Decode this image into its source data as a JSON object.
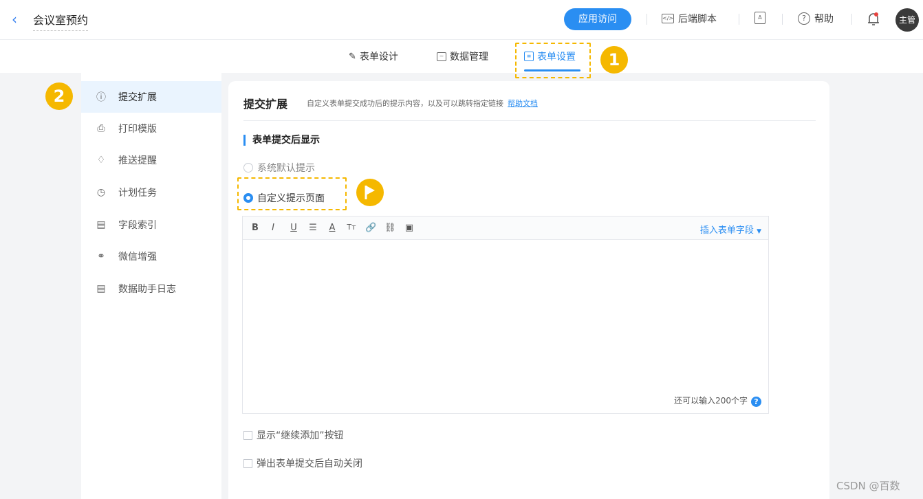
{
  "topbar": {
    "back_icon": "chevron-left-icon",
    "app_title": "会议室预约",
    "visit_button": "应用访问",
    "backend_script": "后端脚本",
    "help": "帮助",
    "avatar_text": "主管"
  },
  "tabs": [
    {
      "label": "表单设计",
      "icon": "form-design-icon"
    },
    {
      "label": "数据管理",
      "icon": "chart-icon"
    },
    {
      "label": "表单设置",
      "icon": "form-settings-icon",
      "active": true
    }
  ],
  "badges": {
    "one": "1",
    "two": "2"
  },
  "sidebar": {
    "items": [
      {
        "label": "提交扩展",
        "icon": "info-icon",
        "active": true
      },
      {
        "label": "打印模版",
        "icon": "printer-icon"
      },
      {
        "label": "推送提醒",
        "icon": "bell-icon"
      },
      {
        "label": "计划任务",
        "icon": "clock-icon"
      },
      {
        "label": "字段索引",
        "icon": "document-icon"
      },
      {
        "label": "微信增强",
        "icon": "wechat-icon"
      },
      {
        "label": "数据助手日志",
        "icon": "log-icon"
      }
    ]
  },
  "main": {
    "title": "提交扩展",
    "description": "自定义表单提交成功后的提示内容，以及可以跳转指定链接",
    "help_link": "帮助文档",
    "section_title": "表单提交后显示",
    "radio_options": [
      {
        "label": "系统默认提示",
        "checked": false
      },
      {
        "label": "自定义提示页面",
        "checked": true
      }
    ],
    "editor": {
      "tools": [
        "B",
        "I",
        "U",
        "☰",
        "A",
        "Tт",
        "🔗",
        "⛓",
        "▣"
      ],
      "insert_field": "插入表单字段",
      "remaining": "还可以输入200个字",
      "help": "?"
    },
    "checkboxes": [
      {
        "label": "显示“继续添加”按钮",
        "checked": false
      },
      {
        "label": "弹出表单提交后自动关闭",
        "checked": false
      }
    ]
  },
  "watermark": "CSDN @百数",
  "colors": {
    "accent": "#2a8ef2",
    "highlight": "#f5b800"
  }
}
